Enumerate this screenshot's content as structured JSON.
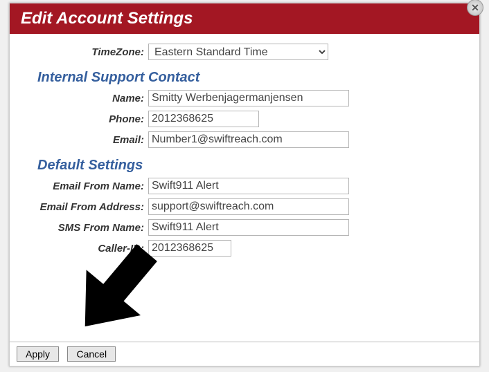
{
  "header": {
    "title": "Edit Account Settings"
  },
  "timezone": {
    "label": "TimeZone:",
    "value": "Eastern Standard Time"
  },
  "sections": {
    "contact": {
      "title": "Internal Support Contact",
      "name_label": "Name:",
      "name_value": "Smitty Werbenjagermanjensen",
      "phone_label": "Phone:",
      "phone_value": "2012368625",
      "email_label": "Email:",
      "email_value": "Number1@swiftreach.com"
    },
    "defaults": {
      "title": "Default Settings",
      "emailfromname_label": "Email From Name:",
      "emailfromname_value": "Swift911 Alert",
      "emailfromaddr_label": "Email From Address:",
      "emailfromaddr_value": "support@swiftreach.com",
      "smsfromname_label": "SMS From Name:",
      "smsfromname_value": "Swift911 Alert",
      "callerid_label": "Caller-ID:",
      "callerid_value": "2012368625"
    }
  },
  "buttons": {
    "apply": "Apply",
    "cancel": "Cancel"
  }
}
